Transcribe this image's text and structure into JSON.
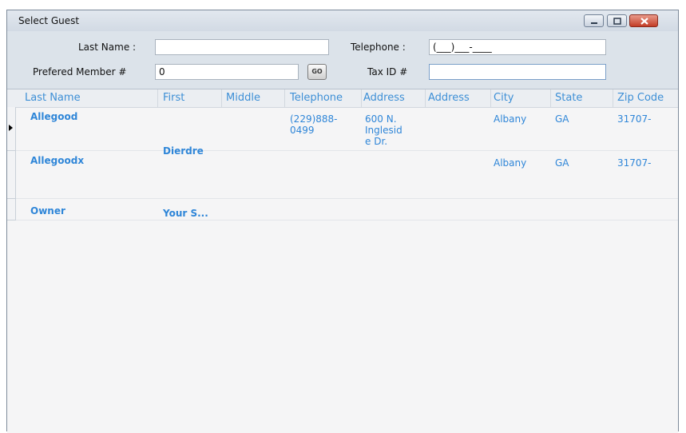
{
  "window": {
    "title": "Select Guest"
  },
  "form": {
    "last_name_label": "Last Name :",
    "last_name_value": "",
    "member_label": "Prefered Member #",
    "member_value": "0",
    "go_label": "GO",
    "telephone_label": "Telephone :",
    "telephone_value": "(___)___-____",
    "tax_label": "Tax ID #",
    "tax_value": ""
  },
  "grid": {
    "columns": [
      "Last Name",
      "First",
      "Middle",
      "Telephone",
      "Address",
      "Address",
      "City",
      "State",
      "Zip Code"
    ],
    "rows": [
      {
        "last_name": "Allegood",
        "first": "",
        "middle": "",
        "telephone_line1": "(229)888-",
        "telephone_line2": "0499",
        "address_line1": "600 N.",
        "address_line2": "Inglesid",
        "address_line3": "e Dr.",
        "address2": "",
        "city": "Albany",
        "state": "GA",
        "zip": "31707-"
      },
      {
        "last_name": "Allegoodx",
        "first": "Dierdre",
        "middle": "",
        "telephone_line1": "",
        "telephone_line2": "",
        "address_line1": "",
        "address_line2": "",
        "address_line3": "",
        "address2": "",
        "city": "Albany",
        "state": "GA",
        "zip": "31707-"
      },
      {
        "last_name": "Owner",
        "first": "Your S...",
        "middle": "",
        "telephone_line1": "",
        "telephone_line2": "",
        "address_line1": "",
        "address_line2": "",
        "address_line3": "",
        "address2": "",
        "city": "",
        "state": "",
        "zip": ""
      }
    ]
  },
  "icons": {
    "current_row": "row-pointer-icon",
    "minimize": "minimize-icon",
    "maximize": "maximize-icon",
    "close": "close-icon"
  }
}
